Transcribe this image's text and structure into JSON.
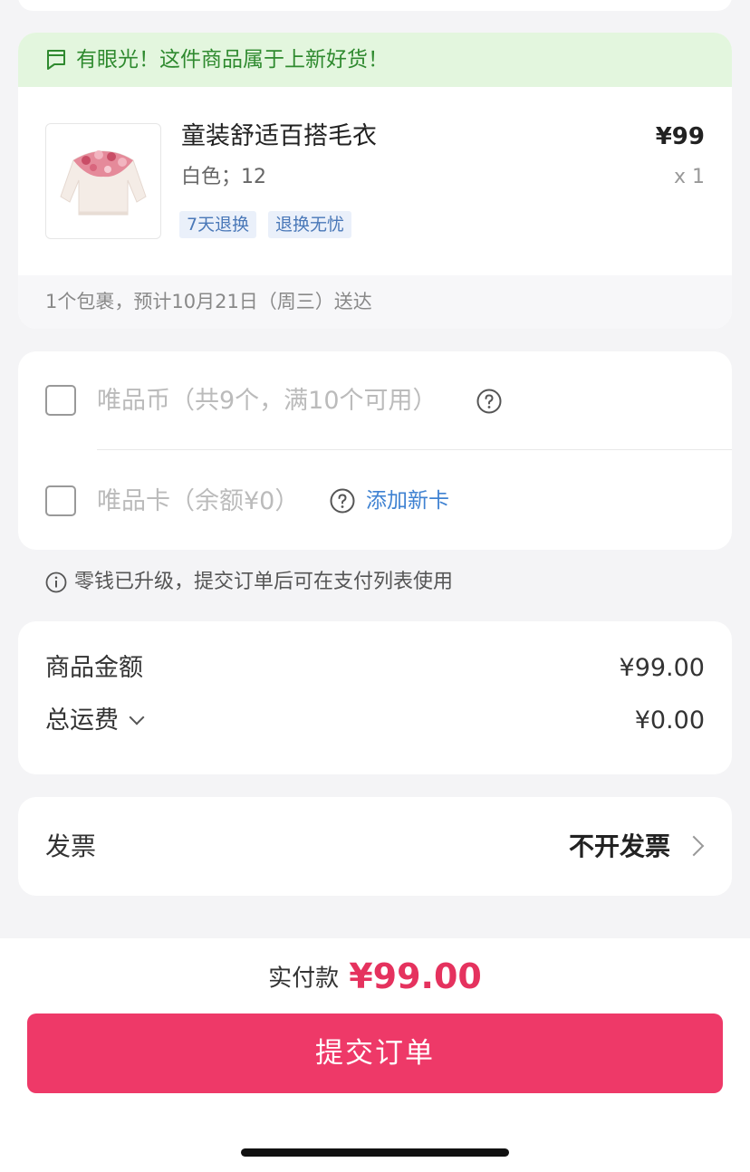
{
  "colors": {
    "accent": "#ee3968",
    "price_accent": "#e5325e",
    "banner_bg": "#e3f6de",
    "banner_text": "#2f8a2f",
    "link": "#3f82d2",
    "tag_text": "#4a78b8"
  },
  "product_card": {
    "banner_icon": "flag-icon",
    "banner_text": "有眼光！这件商品属于上新好货！",
    "product": {
      "title": "童装舒适百搭毛衣",
      "spec": "白色；12",
      "price": "¥99",
      "quantity": "x 1",
      "tags": [
        "7天退换",
        "退换无忧"
      ]
    },
    "delivery": "1个包裹，预计10月21日（周三）送达"
  },
  "vip": {
    "coin_label": "唯品币（共9个，满10个可用）",
    "card_label": "唯品卡（余额¥0）",
    "help_icon": "question-circle-icon",
    "add_card": "添加新卡"
  },
  "notice": {
    "icon": "info-circle-icon",
    "text": "零钱已升级，提交订单后可在支付列表使用"
  },
  "amounts": {
    "goods_label": "商品金额",
    "goods_value": "¥99.00",
    "shipping_label": "总运费",
    "shipping_value": "¥0.00"
  },
  "invoice": {
    "label": "发票",
    "value": "不开发票"
  },
  "footer": {
    "pay_label": "实付款",
    "pay_amount": "¥99.00",
    "submit": "提交订单"
  }
}
